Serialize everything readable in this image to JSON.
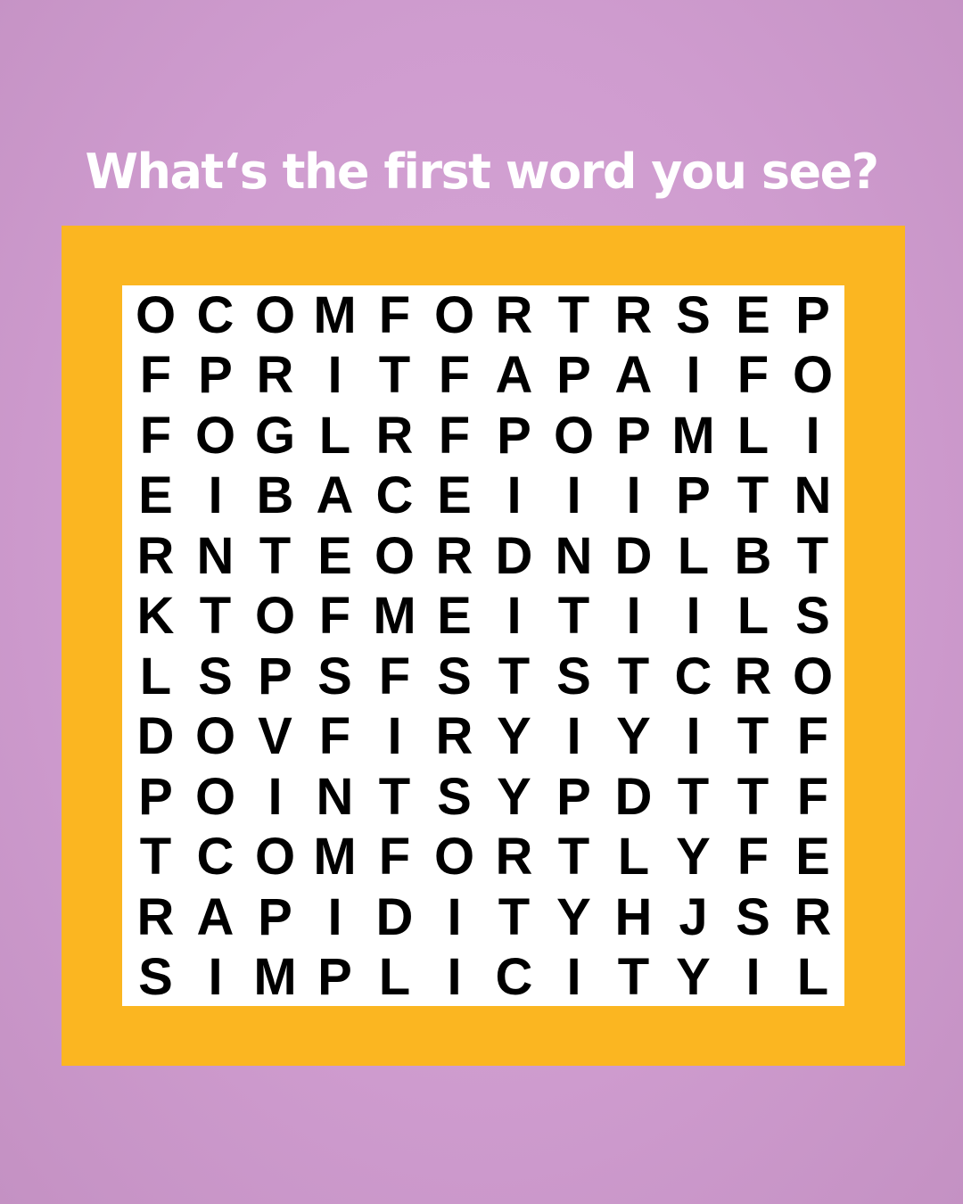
{
  "header": {
    "title": "What‘s the first word you see?"
  },
  "colors": {
    "background": "#cf9ccf",
    "frame": "#fbb621",
    "board": "#ffffff",
    "letters": "#000000",
    "title": "#ffffff"
  },
  "puzzle": {
    "rows": [
      [
        "O",
        "C",
        "O",
        "M",
        "F",
        "O",
        "R",
        "T",
        "R",
        "S",
        "E",
        "P"
      ],
      [
        "F",
        "P",
        "R",
        "I",
        "T",
        "F",
        "A",
        "P",
        "A",
        "I",
        "F",
        "O"
      ],
      [
        "F",
        "O",
        "G",
        "L",
        "R",
        "F",
        "P",
        "O",
        "P",
        "M",
        "L",
        "I"
      ],
      [
        "E",
        "I",
        "B",
        "A",
        "C",
        "E",
        "I",
        "I",
        "I",
        "P",
        "T",
        "N"
      ],
      [
        "R",
        "N",
        "T",
        "E",
        "O",
        "R",
        "D",
        "N",
        "D",
        "L",
        "B",
        "T"
      ],
      [
        "K",
        "T",
        "O",
        "F",
        "M",
        "E",
        "I",
        "T",
        "I",
        "I",
        "L",
        "S"
      ],
      [
        "L",
        "S",
        "P",
        "S",
        "F",
        "S",
        "T",
        "S",
        "T",
        "C",
        "R",
        "O"
      ],
      [
        "D",
        "O",
        "V",
        "F",
        "I",
        "R",
        "Y",
        "I",
        "Y",
        "I",
        "T",
        "F"
      ],
      [
        "P",
        "O",
        "I",
        "N",
        "T",
        "S",
        "Y",
        "P",
        "D",
        "T",
        "T",
        "F"
      ],
      [
        "T",
        "C",
        "O",
        "M",
        "F",
        "O",
        "R",
        "T",
        "L",
        "Y",
        "F",
        "E"
      ],
      [
        "R",
        "A",
        "P",
        "I",
        "D",
        "I",
        "T",
        "Y",
        "H",
        "J",
        "S",
        "R"
      ],
      [
        "S",
        "I",
        "M",
        "P",
        "L",
        "I",
        "C",
        "I",
        "T",
        "Y",
        "I",
        "L"
      ]
    ]
  }
}
